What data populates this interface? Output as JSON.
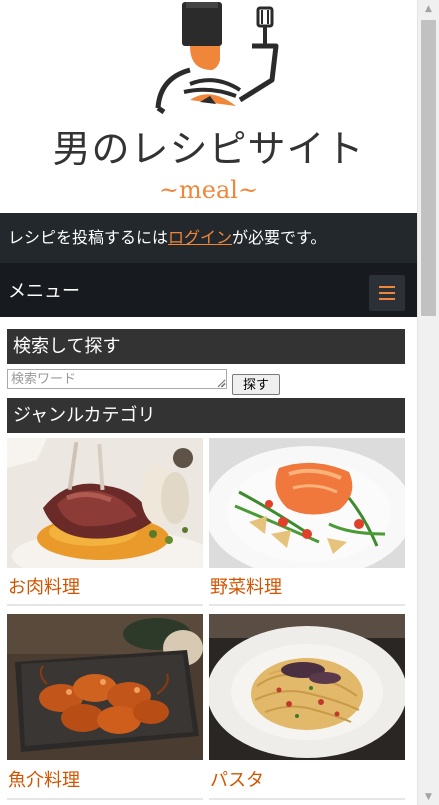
{
  "header": {
    "title": "男のレシピサイト",
    "subtitle": "~meal~"
  },
  "login_bar": {
    "prefix": "レシピを投稿するには",
    "link_label": "ログイン",
    "suffix": "が必要です。"
  },
  "menu": {
    "label": "メニュー",
    "toggle_icon": "hamburger-icon"
  },
  "search": {
    "heading": "検索して探す",
    "placeholder": "検索ワード",
    "button_label": "探す"
  },
  "genre": {
    "heading": "ジャンルカテゴリ",
    "categories": [
      {
        "label": "お肉料理"
      },
      {
        "label": "野菜料理"
      },
      {
        "label": "魚介料理"
      },
      {
        "label": "パスタ"
      }
    ]
  },
  "colors": {
    "accent": "#f0863a",
    "link_text": "#d35400",
    "dark_bar": "#23282d",
    "menu_bar": "#171b1f",
    "widget_header": "#333333"
  }
}
